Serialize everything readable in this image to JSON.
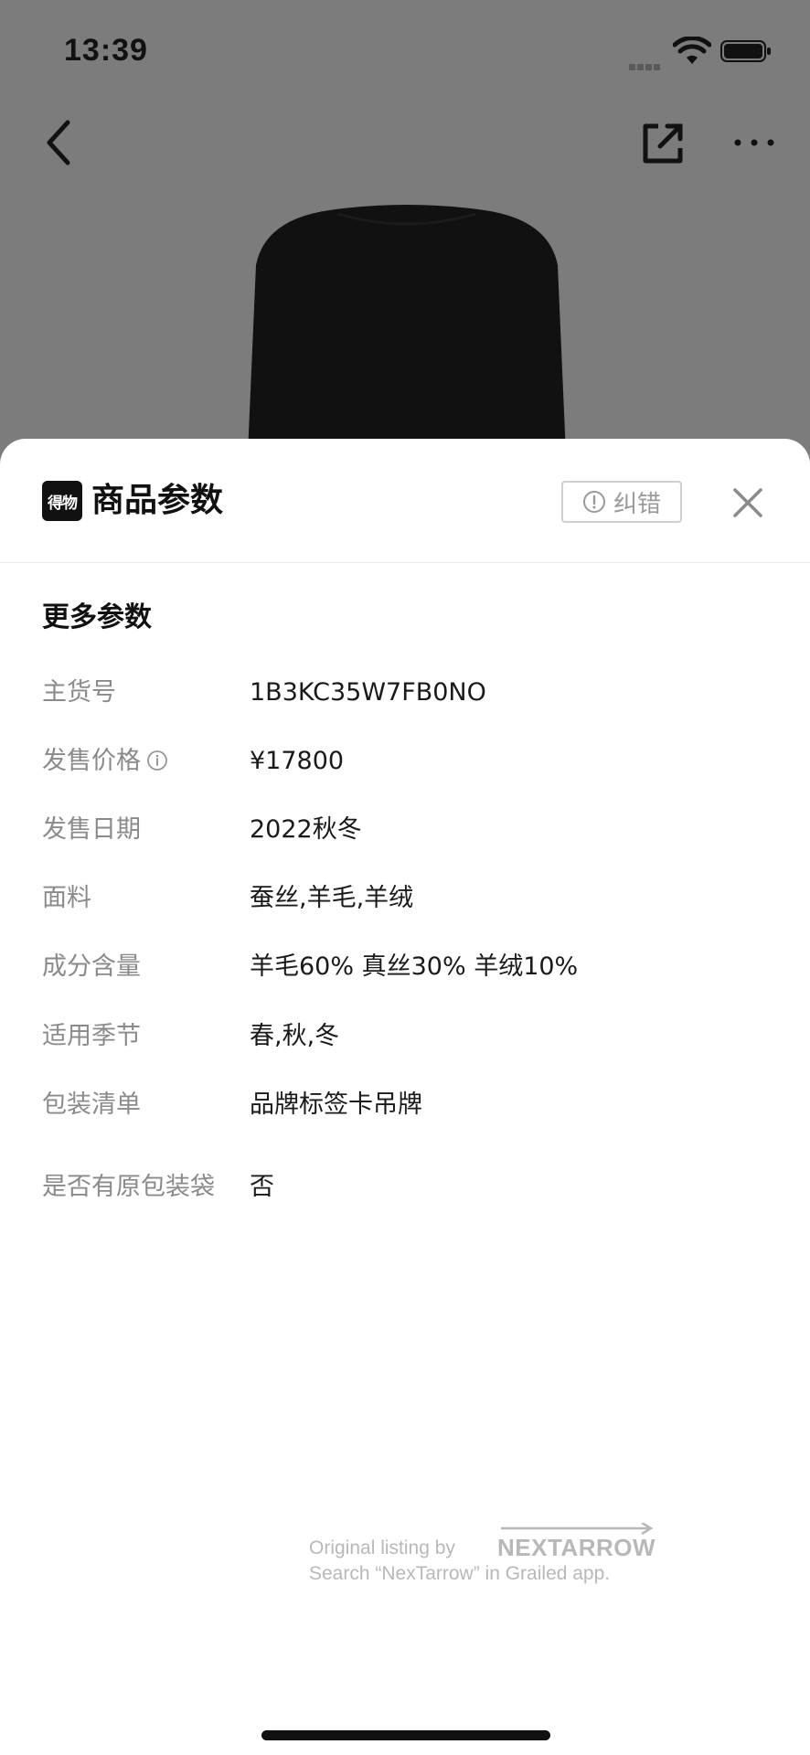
{
  "status_bar": {
    "time": "13:39"
  },
  "sheet": {
    "title": "商品参数",
    "brand_logo_text": "得物",
    "report_label": "纠错",
    "section_title": "更多参数"
  },
  "params": [
    {
      "label": "主货号",
      "value": "1B3KC35W7FB0NO"
    },
    {
      "label": "发售价格",
      "value": "¥17800"
    },
    {
      "label": "发售日期",
      "value": "2022秋冬"
    },
    {
      "label": "面料",
      "value": "蚕丝,羊毛,羊绒"
    },
    {
      "label": "成分含量",
      "value": "羊毛60% 真丝30% 羊绒10%"
    },
    {
      "label": "适用季节",
      "value": "春,秋,冬"
    },
    {
      "label": "包装清单",
      "value": "品牌标签卡吊牌"
    },
    {
      "label": "是否有原包装袋",
      "value": "否"
    }
  ],
  "watermark": {
    "line1": "Original listing by",
    "line2": "Search “NexTarrow” in Grailed app.",
    "logo_text": "NEXTARROW"
  },
  "colors": {
    "backdrop": "#7a7a7a",
    "label": "#8a8a8a",
    "value": "#1a1a1a",
    "report_border": "#cfcfcf"
  }
}
